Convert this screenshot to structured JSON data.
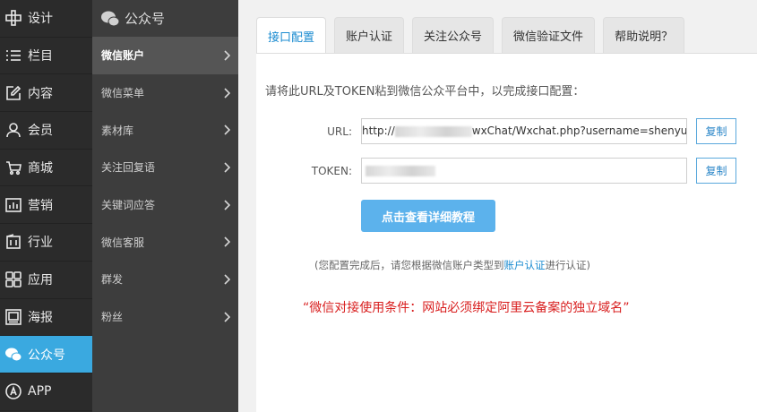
{
  "nav_primary": {
    "items": [
      {
        "label": "设计",
        "icon": "design-icon"
      },
      {
        "label": "栏目",
        "icon": "list-icon"
      },
      {
        "label": "内容",
        "icon": "edit-icon"
      },
      {
        "label": "会员",
        "icon": "user-icon"
      },
      {
        "label": "商城",
        "icon": "cart-icon"
      },
      {
        "label": "营销",
        "icon": "chart-icon"
      },
      {
        "label": "行业",
        "icon": "building-icon"
      },
      {
        "label": "应用",
        "icon": "grid-icon"
      },
      {
        "label": "海报",
        "icon": "image-icon"
      },
      {
        "label": "公众号",
        "icon": "wechat-icon"
      },
      {
        "label": "APP",
        "icon": "app-icon"
      }
    ],
    "active_index": 9
  },
  "nav_secondary": {
    "header": "公众号",
    "items": [
      {
        "label": "微信账户"
      },
      {
        "label": "微信菜单"
      },
      {
        "label": "素材库"
      },
      {
        "label": "关注回复语"
      },
      {
        "label": "关键词应答"
      },
      {
        "label": "微信客服"
      },
      {
        "label": "群发"
      },
      {
        "label": "粉丝"
      }
    ],
    "active_index": 0
  },
  "tabs": [
    {
      "label": "接口配置"
    },
    {
      "label": "账户认证"
    },
    {
      "label": "关注公众号"
    },
    {
      "label": "微信验证文件"
    },
    {
      "label": "帮助说明？"
    }
  ],
  "panel": {
    "intro": "请将此URL及TOKEN粘到微信公众平台中，以完成接口配置：",
    "url_label": "URL:",
    "url_prefix": "http://",
    "url_suffix": "wxChat/Wxchat.php?username=shenyu",
    "token_label": "TOKEN:",
    "copy_label": "复制",
    "tutorial_button": "点击查看详细教程",
    "note_before": "(您配置完成后，请您根据微信账户类型到",
    "note_link": "账户认证",
    "note_after": "进行认证)",
    "warning": "“微信对接使用条件：网站必须绑定阿里云备案的独立域名”"
  },
  "colors": {
    "accent": "#3aa9e0",
    "link": "#1a8bd0",
    "warning": "#d81e1e",
    "button": "#5cb2ec"
  }
}
